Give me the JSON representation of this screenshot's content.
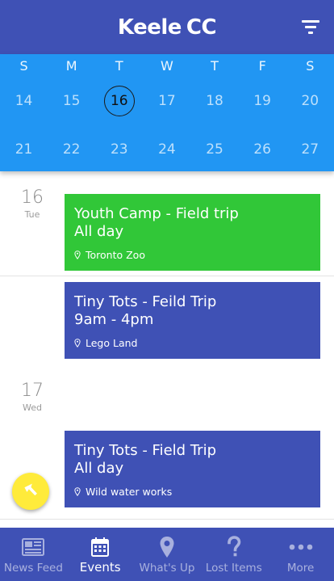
{
  "header": {
    "brand_part1": "Keele",
    "brand_part2": "CC",
    "filter_icon": "filter-icon"
  },
  "calendar": {
    "weekdays": [
      "S",
      "M",
      "T",
      "W",
      "T",
      "F",
      "S"
    ],
    "week1": [
      "14",
      "15",
      "16",
      "17",
      "18",
      "19",
      "20"
    ],
    "week2": [
      "21",
      "22",
      "23",
      "24",
      "25",
      "26",
      "27"
    ],
    "selected_day": "16"
  },
  "days": [
    {
      "num": "16",
      "dow": "Tue"
    },
    {
      "num": "17",
      "dow": "Wed"
    }
  ],
  "events": [
    {
      "title": "Youth Camp - Field trip",
      "time": "All day",
      "location": "Toronto Zoo",
      "color": "#31C738"
    },
    {
      "title": "Tiny Tots - Feild Trip",
      "time": "9am - 4pm",
      "location": "Lego Land",
      "color": "#3F51B5"
    },
    {
      "title": "Tiny Tots - Field Trip",
      "time": "All day",
      "location": "Wild water works",
      "color": "#3F51B5"
    }
  ],
  "fab": {
    "icon": "arrow-icon",
    "color": "#FFEB3B"
  },
  "bottom_nav": [
    {
      "label": "News Feed",
      "icon": "newspaper-icon"
    },
    {
      "label": "Events",
      "icon": "calendar-icon"
    },
    {
      "label": "What's Up",
      "icon": "map-pin-icon"
    },
    {
      "label": "Lost Items",
      "icon": "question-icon"
    },
    {
      "label": "More",
      "icon": "more-dots-icon"
    }
  ],
  "colors": {
    "primary": "#3F51B5",
    "calendar": "#2196F3",
    "accent": "#FFEB3B"
  }
}
